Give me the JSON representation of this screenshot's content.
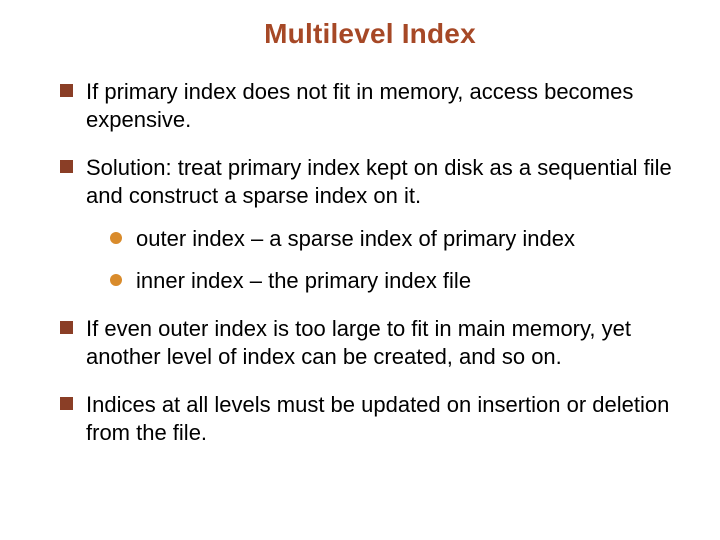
{
  "title": "Multilevel Index",
  "bullets": [
    {
      "text": "If primary index does not fit in memory, access becomes expensive."
    },
    {
      "text": "Solution: treat primary index kept on disk as a sequential file and construct a sparse index on it.",
      "children": [
        {
          "text": "outer index – a sparse index of primary index"
        },
        {
          "text": "inner index – the primary index file"
        }
      ]
    },
    {
      "text": "If even outer index is too large to fit in main memory, yet another level of index can be created, and so on."
    },
    {
      "text": "Indices at all levels must be updated on insertion or deletion from the file."
    }
  ]
}
